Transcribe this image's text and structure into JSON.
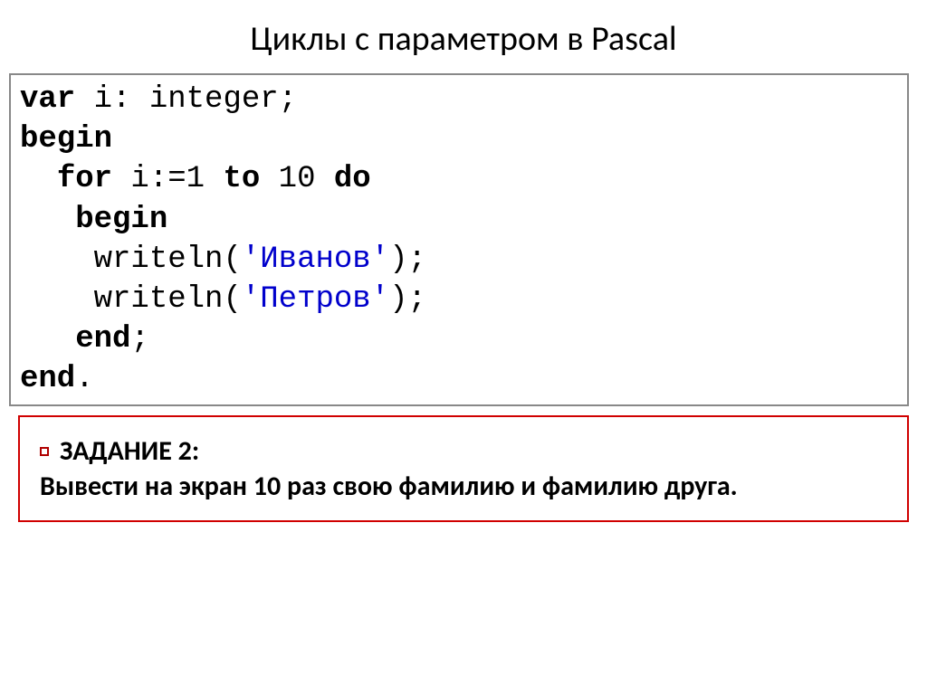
{
  "title": "Циклы с параметром в Pascal",
  "code": {
    "line1_kw": "var",
    "line1_rest": " i: integer;",
    "line2_kw": "begin",
    "line3_indent": "  ",
    "line3_kw1": "for",
    "line3_mid": " i:=1 ",
    "line3_kw2": "to",
    "line3_mid2": " 10 ",
    "line3_kw3": "do",
    "line4_indent": "   ",
    "line4_kw": "begin",
    "line5_indent": "    ",
    "line5_func": "writeln(",
    "line5_str": "'Иванов'",
    "line5_end": ");",
    "line6_indent": "    ",
    "line6_func": "writeln(",
    "line6_str": "'Петров'",
    "line6_end": ");",
    "line7_indent": "   ",
    "line7_kw": "end",
    "line7_end": ";",
    "line8_kw": "end",
    "line8_end": "."
  },
  "task": {
    "header": "ЗАДАНИЕ 2:",
    "body": "Вывести на экран 10 раз свою фамилию и фамилию друга."
  }
}
